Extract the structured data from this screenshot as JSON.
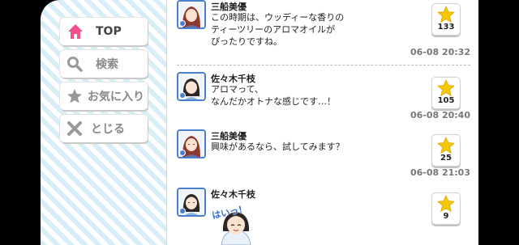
{
  "menu": {
    "top_label": "TOP",
    "search_label": "検索",
    "favorites_label": "お気に入り",
    "close_label": "とじる"
  },
  "posts": [
    {
      "author": "三船美優",
      "message": "この時期は、ウッディーな香りの\nティーツリーのアロマオイルが\nぴったりですね。",
      "timestamp": "06-08 20:32",
      "likes": "133"
    },
    {
      "author": "佐々木千枝",
      "message": "アロマって、\nなんだかオトナな感じです…！",
      "timestamp": "06-08 20:40",
      "likes": "105"
    },
    {
      "author": "三船美優",
      "message": "興味があるなら、試してみます？",
      "timestamp": "06-08 21:03",
      "likes": "25"
    },
    {
      "author": "佐々木千枝",
      "message": "",
      "timestamp": "",
      "likes": "9",
      "sticker_text": "はいっ！"
    }
  ],
  "colors": {
    "accent_pink": "#f0508c",
    "star_yellow": "#f5c800",
    "avatar_border": "#4b7fcf",
    "stripe": "#d8eef6"
  },
  "icons": {
    "top": "home-icon",
    "search": "search-icon",
    "favorites": "star-icon",
    "close": "close-icon",
    "like": "star-icon"
  }
}
